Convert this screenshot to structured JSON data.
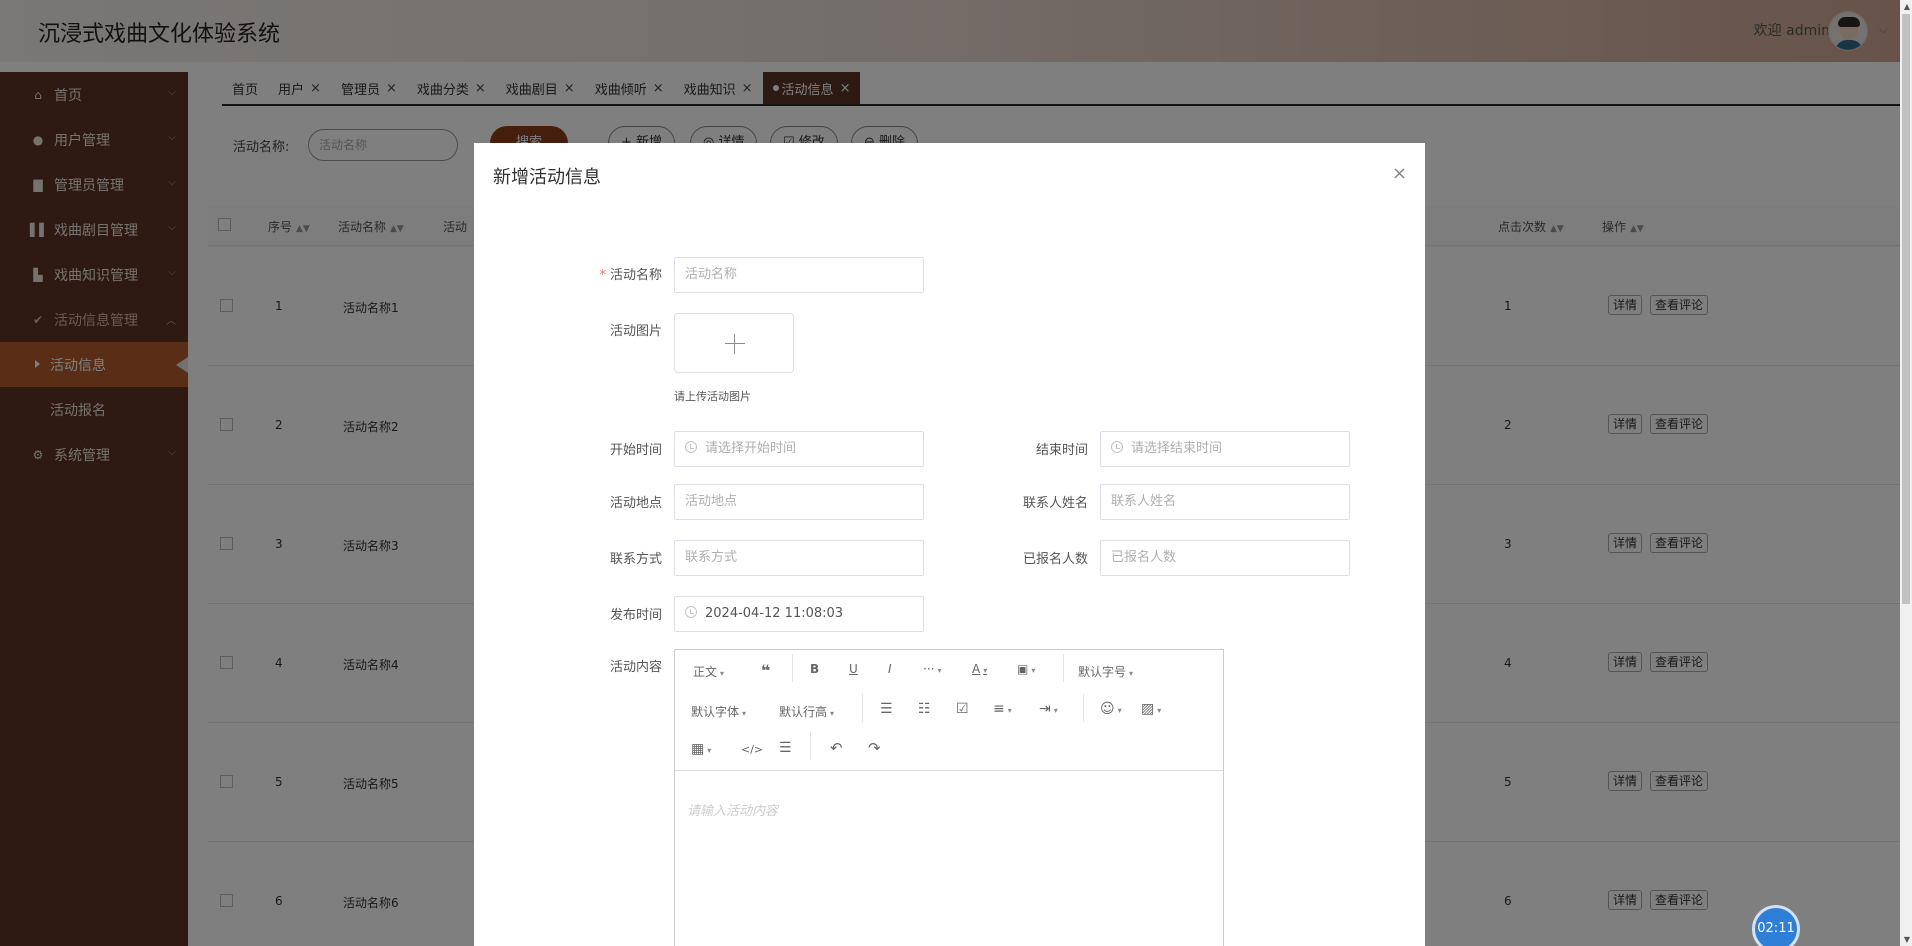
{
  "app": {
    "title": "沉浸式戏曲文化体验系统",
    "welcome": "欢迎 admin"
  },
  "sidebar": {
    "items": [
      {
        "label": "首页",
        "icon": "home-icon"
      },
      {
        "label": "用户管理",
        "icon": "user-icon"
      },
      {
        "label": "管理员管理",
        "icon": "building-icon"
      },
      {
        "label": "戏曲剧目管理",
        "icon": "book-icon"
      },
      {
        "label": "戏曲知识管理",
        "icon": "knowledge-icon"
      },
      {
        "label": "活动信息管理",
        "icon": "activity-icon"
      }
    ],
    "subitems": [
      {
        "label": "活动信息"
      },
      {
        "label": "活动报名"
      }
    ],
    "system": {
      "label": "系统管理",
      "icon": "settings-icon"
    }
  },
  "tabs": [
    {
      "label": "首页",
      "closable": false
    },
    {
      "label": "用户",
      "closable": true
    },
    {
      "label": "管理员",
      "closable": true
    },
    {
      "label": "戏曲分类",
      "closable": true
    },
    {
      "label": "戏曲剧目",
      "closable": true
    },
    {
      "label": "戏曲倾听",
      "closable": true
    },
    {
      "label": "戏曲知识",
      "closable": true
    },
    {
      "label": "活动信息",
      "closable": true,
      "active": true
    }
  ],
  "search": {
    "label": "活动名称:",
    "placeholder": "活动名称",
    "button": "搜索"
  },
  "toolbar_buttons": [
    "+ 新增",
    "◎ 详情",
    "☑ 修改",
    "⊖ 删除"
  ],
  "table": {
    "headers": [
      "序号",
      "活动名称",
      "活动",
      "点击次数",
      "操作"
    ],
    "rows": [
      {
        "index": "1",
        "name": "活动名称1",
        "clicks": "1"
      },
      {
        "index": "2",
        "name": "活动名称2",
        "clicks": "2"
      },
      {
        "index": "3",
        "name": "活动名称3",
        "clicks": "3"
      },
      {
        "index": "4",
        "name": "活动名称4",
        "clicks": "4"
      },
      {
        "index": "5",
        "name": "活动名称5",
        "clicks": "5"
      },
      {
        "index": "6",
        "name": "活动名称6",
        "clicks": "6"
      }
    ],
    "op_detail": "详情",
    "op_comments": "查看评论"
  },
  "dialog": {
    "title": "新增活动信息",
    "close": "×",
    "fields": {
      "name": {
        "label": "活动名称",
        "placeholder": "活动名称",
        "required": true
      },
      "image": {
        "label": "活动图片",
        "tip": "请上传活动图片"
      },
      "start_time": {
        "label": "开始时间",
        "placeholder": "请选择开始时间"
      },
      "end_time": {
        "label": "结束时间",
        "placeholder": "请选择结束时间"
      },
      "location": {
        "label": "活动地点",
        "placeholder": "活动地点"
      },
      "contact_name": {
        "label": "联系人姓名",
        "placeholder": "联系人姓名"
      },
      "contact": {
        "label": "联系方式",
        "placeholder": "联系方式"
      },
      "enrolled": {
        "label": "已报名人数",
        "placeholder": "已报名人数"
      },
      "publish_time": {
        "label": "发布时间",
        "value": "2024-04-12 11:08:03"
      },
      "content": {
        "label": "活动内容",
        "placeholder": "请输入活动内容"
      }
    },
    "editor_toolbar": {
      "paragraph": "正文",
      "font_size": "默认字号",
      "font_family": "默认字体",
      "line_height": "默认行高"
    }
  },
  "timer": "02:11"
}
